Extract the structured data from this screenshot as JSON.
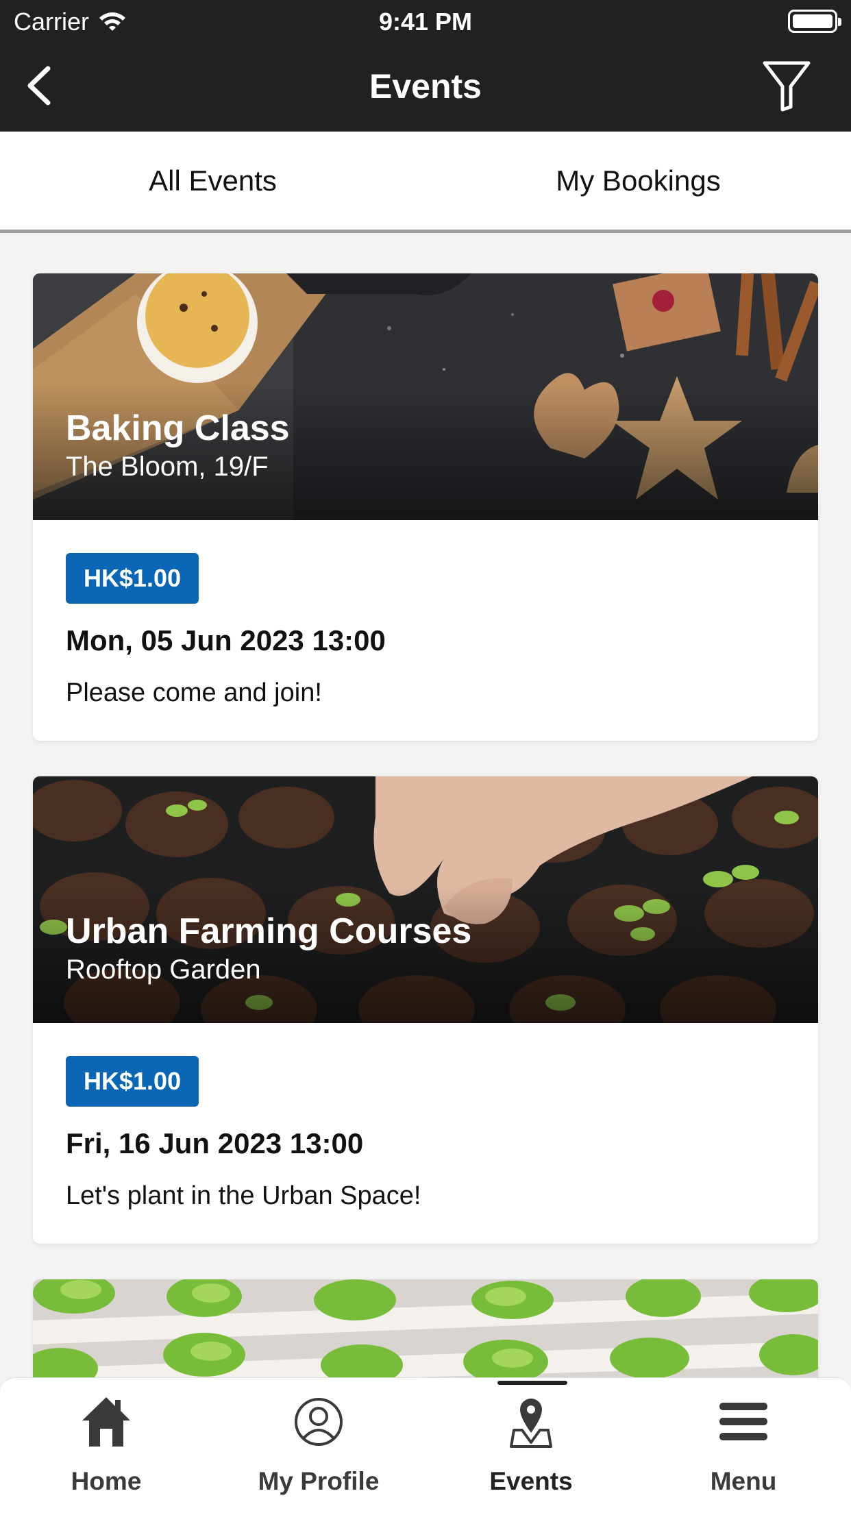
{
  "status": {
    "carrier": "Carrier",
    "time": "9:41 PM"
  },
  "nav": {
    "title": "Events",
    "back_icon": "chevron-left-icon",
    "filter_icon": "filter-icon"
  },
  "tabs": [
    {
      "label": "All Events"
    },
    {
      "label": "My Bookings"
    }
  ],
  "events": [
    {
      "title": "Baking Class",
      "location": "The Bloom, 19/F",
      "price": "HK$1.00",
      "date": "Mon, 05 Jun 2023 13:00",
      "description": "Please come and join!"
    },
    {
      "title": "Urban Farming Courses",
      "location": "Rooftop Garden",
      "price": "HK$1.00",
      "date": "Fri, 16 Jun 2023 13:00",
      "description": "Let's plant in the Urban Space!"
    }
  ],
  "tabbar": [
    {
      "label": "Home",
      "icon": "home-icon"
    },
    {
      "label": "My Profile",
      "icon": "profile-icon"
    },
    {
      "label": "Events",
      "icon": "events-pin-icon",
      "active": true
    },
    {
      "label": "Menu",
      "icon": "menu-icon"
    }
  ],
  "colors": {
    "header": "#212121",
    "price_badge": "#0b67b5",
    "background": "#f2f2f2"
  }
}
